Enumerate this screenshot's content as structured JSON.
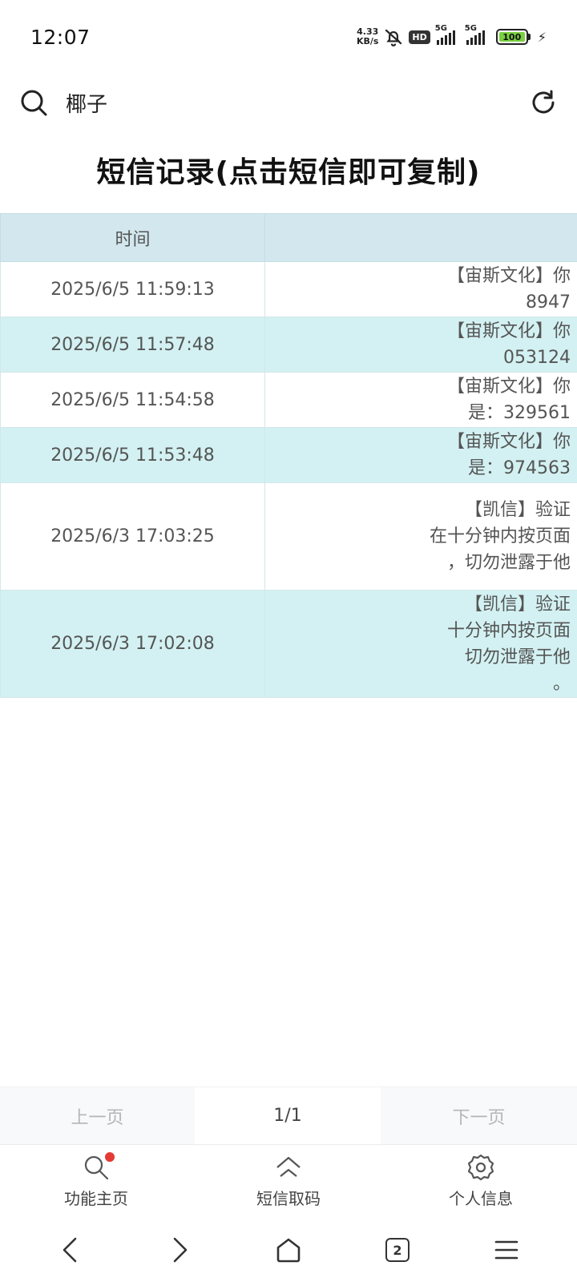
{
  "status": {
    "time": "12:07",
    "net_speed_value": "4.33",
    "net_speed_unit": "KB/s",
    "hd_label": "HD",
    "sim1_label": "5G",
    "sim2_label": "5G",
    "battery": "100"
  },
  "header": {
    "title": "椰子"
  },
  "page_title": "短信记录(点击短信即可复制)",
  "table": {
    "headers": [
      "时间",
      ""
    ],
    "rows": [
      {
        "time": "2025/6/5 11:59:13",
        "message": "【宙斯文化】你\n8947"
      },
      {
        "time": "2025/6/5 11:57:48",
        "message": "【宙斯文化】你\n053124"
      },
      {
        "time": "2025/6/5 11:54:58",
        "message": "【宙斯文化】你\n是：329561"
      },
      {
        "time": "2025/6/5 11:53:48",
        "message": "【宙斯文化】你\n是：974563"
      },
      {
        "time": "2025/6/3 17:03:25",
        "message": "【凯信】验证\n在十分钟内按页面\n，切勿泄露于他"
      },
      {
        "time": "2025/6/3 17:02:08",
        "message": "【凯信】验证\n十分钟内按页面\n切勿泄露于他\n。"
      }
    ]
  },
  "pager": {
    "prev": "上一页",
    "page": "1/1",
    "next": "下一页"
  },
  "tabs": [
    {
      "label": "功能主页",
      "icon": "search-icon"
    },
    {
      "label": "短信取码",
      "icon": "home-icon"
    },
    {
      "label": "个人信息",
      "icon": "gear-icon"
    }
  ],
  "nav": {
    "tab_count": "2"
  }
}
